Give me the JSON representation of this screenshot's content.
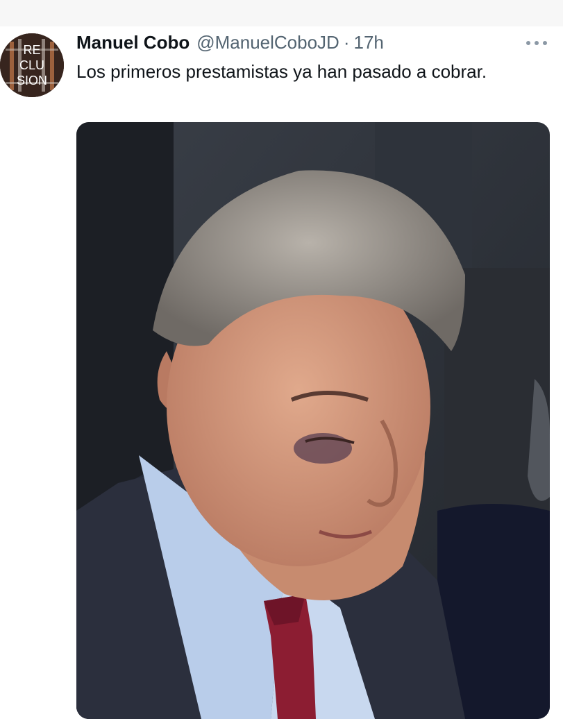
{
  "tweet": {
    "author_name": "Manuel Cobo",
    "author_handle": "@ManuelCoboJD",
    "separator": "·",
    "timestamp": "17h",
    "text": "Los primeros prestamistas ya han pasado a cobrar.",
    "avatar_icon": "avatar-logo-icon",
    "avatar_text_lines": [
      "RE",
      "CLU",
      "SION"
    ],
    "more_icon": "more-options-icon"
  },
  "colors": {
    "name": "#0f1419",
    "secondary": "#536471",
    "background": "#ffffff"
  }
}
